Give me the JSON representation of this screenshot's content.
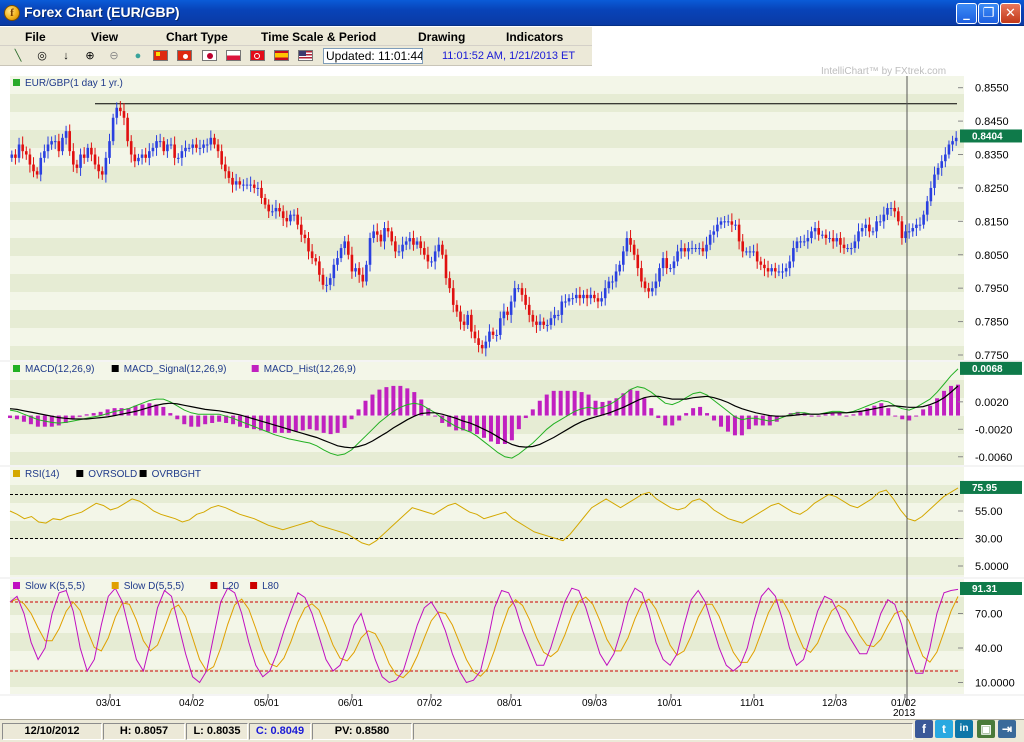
{
  "window": {
    "title": "Forex Chart (EUR/GBP)",
    "app_icon_glyph": "f",
    "controls": [
      "_",
      "❐",
      "✕"
    ]
  },
  "menu": [
    "File",
    "View",
    "Chart Type",
    "Time Scale & Period",
    "Drawing",
    "Indicators"
  ],
  "toolbar": {
    "tools": [
      {
        "name": "line-tool-icon",
        "glyph": "╲"
      },
      {
        "name": "crosshair-icon",
        "glyph": "◎"
      },
      {
        "name": "arrow-down-icon",
        "glyph": "↓"
      },
      {
        "name": "zoom-in-icon",
        "glyph": "⊕"
      },
      {
        "name": "zoom-out-icon",
        "glyph": "⊖"
      },
      {
        "name": "globe-icon",
        "glyph": "●"
      }
    ],
    "flags": [
      {
        "name": "flag-china-icon",
        "colors": [
          "#de2910",
          "#de2910"
        ]
      },
      {
        "name": "flag-hong-kong-icon",
        "colors": [
          "#de2910",
          "#de2910"
        ]
      },
      {
        "name": "flag-japan-icon",
        "colors": [
          "#ffffff",
          "#bc002d"
        ]
      },
      {
        "name": "flag-poland-icon",
        "colors": [
          "#ffffff",
          "#dc143c"
        ]
      },
      {
        "name": "flag-turkey-icon",
        "colors": [
          "#e30a17",
          "#e30a17"
        ]
      },
      {
        "name": "flag-spain-icon",
        "colors": [
          "#c60b1e",
          "#ffc400"
        ]
      },
      {
        "name": "flag-usa-icon",
        "colors": [
          "#b22234",
          "#3c3b6e"
        ]
      }
    ],
    "updated_label": "Updated: 11:01:44",
    "updated_time": "11:01:52 AM, 1/21/2013 ET"
  },
  "watermark": "IntelliChart™ by FXtrek.com",
  "colors": {
    "up_candle": "#2a40e0",
    "down_candle": "#e01010",
    "macd": "#22b022",
    "signal": "#000000",
    "hist": "#c020c0",
    "rsi": "#d4a800",
    "slow_k": "#c010c0",
    "slow_d": "#e0a000",
    "band_light": "#f3f6e8",
    "band_dark": "#e6ecd4",
    "tag_bg": "#0f7a4a"
  },
  "chart_data": [
    {
      "type": "candlestick",
      "legend": "EUR/GBP(1 day  1 yr.)",
      "y_ticks": [
        "0.8550",
        "0.8450",
        "0.8350",
        "0.8250",
        "0.8150",
        "0.8050",
        "0.7950",
        "0.7850",
        "0.7750"
      ],
      "ylim": [
        0.7735,
        0.8585
      ],
      "last_value": "0.8404",
      "resistance": 0.8502,
      "x_labels": [
        "03/01",
        "04/02",
        "05/01",
        "06/01",
        "07/02",
        "08/01",
        "09/03",
        "10/01",
        "11/01",
        "12/03",
        "01/02"
      ],
      "year_label": "2013",
      "closes": [
        0.835,
        0.834,
        0.838,
        0.836,
        0.835,
        0.832,
        0.83,
        0.829,
        0.834,
        0.836,
        0.838,
        0.839,
        0.839,
        0.836,
        0.84,
        0.842,
        0.836,
        0.832,
        0.831,
        0.835,
        0.834,
        0.837,
        0.835,
        0.832,
        0.83,
        0.829,
        0.834,
        0.839,
        0.846,
        0.849,
        0.848,
        0.846,
        0.839,
        0.835,
        0.833,
        0.834,
        0.835,
        0.834,
        0.836,
        0.837,
        0.839,
        0.839,
        0.836,
        0.838,
        0.838,
        0.834,
        0.834,
        0.836,
        0.837,
        0.837,
        0.838,
        0.837,
        0.837,
        0.838,
        0.838,
        0.84,
        0.838,
        0.836,
        0.832,
        0.83,
        0.828,
        0.826,
        0.827,
        0.826,
        0.826,
        0.826,
        0.826,
        0.825,
        0.825,
        0.822,
        0.82,
        0.818,
        0.818,
        0.819,
        0.818,
        0.816,
        0.815,
        0.817,
        0.817,
        0.814,
        0.811,
        0.81,
        0.806,
        0.804,
        0.803,
        0.799,
        0.796,
        0.796,
        0.798,
        0.802,
        0.804,
        0.807,
        0.809,
        0.805,
        0.8,
        0.801,
        0.799,
        0.797,
        0.802,
        0.81,
        0.812,
        0.811,
        0.809,
        0.813,
        0.812,
        0.809,
        0.806,
        0.806,
        0.808,
        0.809,
        0.81,
        0.808,
        0.809,
        0.807,
        0.805,
        0.803,
        0.803,
        0.806,
        0.808,
        0.805,
        0.798,
        0.795,
        0.79,
        0.788,
        0.785,
        0.784,
        0.787,
        0.782,
        0.78,
        0.778,
        0.777,
        0.779,
        0.782,
        0.781,
        0.781,
        0.786,
        0.788,
        0.787,
        0.791,
        0.795,
        0.795,
        0.793,
        0.79,
        0.787,
        0.785,
        0.784,
        0.785,
        0.784,
        0.784,
        0.786,
        0.787,
        0.787,
        0.791,
        0.791,
        0.792,
        0.792,
        0.793,
        0.792,
        0.793,
        0.792,
        0.793,
        0.792,
        0.791,
        0.792,
        0.795,
        0.797,
        0.797,
        0.8,
        0.802,
        0.806,
        0.81,
        0.808,
        0.805,
        0.801,
        0.797,
        0.795,
        0.794,
        0.795,
        0.797,
        0.801,
        0.804,
        0.801,
        0.801,
        0.803,
        0.806,
        0.807,
        0.806,
        0.807,
        0.807,
        0.807,
        0.807,
        0.806,
        0.808,
        0.811,
        0.812,
        0.814,
        0.815,
        0.815,
        0.815,
        0.814,
        0.814,
        0.809,
        0.806,
        0.806,
        0.806,
        0.806,
        0.803,
        0.802,
        0.801,
        0.8,
        0.801,
        0.8,
        0.8,
        0.8,
        0.801,
        0.803,
        0.807,
        0.809,
        0.809,
        0.809,
        0.81,
        0.812,
        0.813,
        0.811,
        0.811,
        0.81,
        0.81,
        0.809,
        0.81,
        0.808,
        0.807,
        0.807,
        0.807,
        0.809,
        0.812,
        0.813,
        0.814,
        0.812,
        0.812,
        0.815,
        0.815,
        0.817,
        0.819,
        0.819,
        0.818,
        0.815,
        0.81,
        0.812,
        0.812,
        0.813,
        0.814,
        0.814,
        0.817,
        0.821,
        0.825,
        0.829,
        0.831,
        0.833,
        0.835,
        0.838,
        0.839,
        0.84
      ],
      "indicator_series_note": "indicator panels follow"
    },
    {
      "type": "line",
      "legend": [
        "MACD(12,26,9)",
        "MACD_Signal(12,26,9)",
        "MACD_Hist(12,26,9)"
      ],
      "y_ticks": [
        "0.0020",
        "-0.0020",
        "-0.0060"
      ],
      "last_value": "0.0068",
      "macd": [
        0.0008,
        0.0006,
        0.0002,
        -0.0002,
        -0.0006,
        -0.0008,
        -0.001,
        -0.0011,
        -0.001,
        -0.0008,
        -0.0006,
        -0.0004,
        -0.0002,
        0.0,
        0.0003,
        0.0006,
        0.0008,
        0.001,
        0.0014,
        0.0018,
        0.0022,
        0.0024,
        0.0024,
        0.002,
        0.0014,
        0.0008,
        0.0004,
        0.0002,
        0.0002,
        0.0002,
        0.0002,
        -0.0001,
        -0.0004,
        -0.0008,
        -0.0012,
        -0.0016,
        -0.002,
        -0.0024,
        -0.0028,
        -0.0031,
        -0.0034,
        -0.0036,
        -0.0038,
        -0.004,
        -0.0044,
        -0.005,
        -0.0055,
        -0.0058,
        -0.0056,
        -0.005,
        -0.004,
        -0.003,
        -0.002,
        -0.001,
        -0.0002,
        0.0006,
        0.0012,
        0.0016,
        0.0018,
        0.0016,
        0.001,
        0.0004,
        -0.0004,
        -0.001,
        -0.0016,
        -0.002,
        -0.0024,
        -0.003,
        -0.0038,
        -0.0046,
        -0.0054,
        -0.006,
        -0.0062,
        -0.0056,
        -0.0048,
        -0.004,
        -0.003,
        -0.002,
        -0.0012,
        -0.0006,
        0.0,
        0.0006,
        0.001,
        0.0012,
        0.001,
        0.0012,
        0.0016,
        0.0022,
        0.003,
        0.0038,
        0.0042,
        0.004,
        0.0034,
        0.0026,
        0.0018,
        0.0016,
        0.002,
        0.0026,
        0.0032,
        0.0034,
        0.003,
        0.0022,
        0.0014,
        0.0006,
        -0.0002,
        -0.0006,
        -0.0004,
        -0.0004,
        -0.0006,
        -0.0008,
        -0.0006,
        -0.0002,
        0.0002,
        0.0004,
        0.0004,
        0.0002,
        0.0002,
        0.0004,
        0.0006,
        0.0006,
        0.0004,
        0.0006,
        0.001,
        0.0014,
        0.0018,
        0.0022,
        0.002,
        0.0014,
        0.001,
        0.0008,
        0.0012,
        0.0018,
        0.0024,
        0.0034,
        0.0046,
        0.0058,
        0.0068
      ],
      "signal": [
        0.001,
        0.0009,
        0.0007,
        0.0005,
        0.0003,
        0.0001,
        -0.0001,
        -0.0003,
        -0.0004,
        -0.0005,
        -0.0005,
        -0.0005,
        -0.0004,
        -0.0003,
        -0.0002,
        0.0,
        0.0002,
        0.0004,
        0.0006,
        0.0009,
        0.0012,
        0.0015,
        0.0017,
        0.0018,
        0.0017,
        0.0015,
        0.0013,
        0.0011,
        0.0009,
        0.0008,
        0.0007,
        0.0005,
        0.0003,
        0.0001,
        -0.0002,
        -0.0005,
        -0.0008,
        -0.0011,
        -0.0014,
        -0.0017,
        -0.002,
        -0.0023,
        -0.0026,
        -0.0029,
        -0.0032,
        -0.0036,
        -0.004,
        -0.0044,
        -0.0046,
        -0.0047,
        -0.0045,
        -0.0042,
        -0.0037,
        -0.0031,
        -0.0025,
        -0.0018,
        -0.0012,
        -0.0006,
        -0.0001,
        0.0003,
        0.0004,
        0.0004,
        0.0002,
        -0.0001,
        -0.0004,
        -0.0008,
        -0.0011,
        -0.0015,
        -0.002,
        -0.0025,
        -0.0031,
        -0.0037,
        -0.0042,
        -0.0045,
        -0.0046,
        -0.0045,
        -0.0042,
        -0.0037,
        -0.0032,
        -0.0026,
        -0.002,
        -0.0014,
        -0.0009,
        -0.0005,
        -0.0002,
        0.0001,
        0.0004,
        0.0008,
        0.0012,
        0.0017,
        0.0022,
        0.0026,
        0.0028,
        0.0028,
        0.0026,
        0.0024,
        0.0024,
        0.0024,
        0.0026,
        0.0027,
        0.0028,
        0.0026,
        0.0023,
        0.0019,
        0.0014,
        0.001,
        0.0007,
        0.0004,
        0.0002,
        0.0,
        -0.0001,
        -0.0001,
        0.0,
        0.0001,
        0.0002,
        0.0002,
        0.0002,
        0.0003,
        0.0004,
        0.0004,
        0.0004,
        0.0005,
        0.0006,
        0.0008,
        0.001,
        0.0012,
        0.0014,
        0.0014,
        0.0013,
        0.0012,
        0.0012,
        0.0013,
        0.0016,
        0.002,
        0.0026,
        0.0034,
        0.0043
      ]
    },
    {
      "type": "line",
      "legend": [
        "RSI(14)",
        "OVRSOLD",
        "OVRBGHT"
      ],
      "y_ticks": [
        "55.00",
        "30.00",
        "5.0000"
      ],
      "last_value": "75.95",
      "overbought": 70,
      "oversold": 30,
      "rsi": [
        55,
        52,
        48,
        50,
        45,
        44,
        48,
        47,
        50,
        52,
        54,
        58,
        62,
        60,
        56,
        58,
        62,
        66,
        64,
        60,
        55,
        52,
        50,
        48,
        45,
        47,
        52,
        54,
        58,
        60,
        58,
        55,
        52,
        50,
        48,
        45,
        42,
        40,
        38,
        40,
        42,
        44,
        46,
        42,
        40,
        38,
        36,
        34,
        30,
        26,
        24,
        28,
        34,
        40,
        46,
        52,
        58,
        56,
        54,
        52,
        56,
        60,
        62,
        58,
        54,
        52,
        48,
        50,
        52,
        54,
        48,
        44,
        40,
        36,
        34,
        32,
        30,
        28,
        34,
        42,
        50,
        58,
        62,
        66,
        62,
        58,
        62,
        66,
        70,
        72,
        66,
        62,
        58,
        56,
        58,
        64,
        66,
        62,
        56,
        52,
        48,
        46,
        44,
        48,
        52,
        56,
        60,
        62,
        58,
        54,
        52,
        56,
        62,
        66,
        70,
        68,
        64,
        60,
        58,
        62,
        66,
        72,
        74,
        66,
        56,
        48,
        46,
        50,
        56,
        62,
        68,
        72,
        76
      ]
    },
    {
      "type": "line",
      "legend": [
        "Slow K(5,5,5)",
        "Slow D(5,5,5)",
        "L20",
        "L80"
      ],
      "y_ticks": [
        "70.00",
        "40.00",
        "10.0000"
      ],
      "last_value": "91.31",
      "l80": 80,
      "l20": 20,
      "slow_k": [
        80,
        85,
        70,
        45,
        30,
        40,
        70,
        88,
        90,
        72,
        40,
        20,
        30,
        60,
        85,
        92,
        80,
        55,
        30,
        20,
        45,
        75,
        90,
        85,
        60,
        35,
        15,
        10,
        20,
        50,
        80,
        92,
        88,
        70,
        45,
        25,
        15,
        20,
        35,
        55,
        72,
        88,
        84,
        70,
        50,
        30,
        20,
        25,
        40,
        60,
        70,
        50,
        30,
        15,
        10,
        12,
        20,
        40,
        60,
        75,
        80,
        70,
        55,
        35,
        20,
        10,
        12,
        20,
        45,
        75,
        90,
        88,
        75,
        55,
        40,
        25,
        25,
        40,
        60,
        80,
        92,
        90,
        75,
        55,
        35,
        25,
        35,
        55,
        80,
        92,
        88,
        70,
        45,
        30,
        25,
        35,
        60,
        82,
        90,
        80,
        60,
        40,
        25,
        20,
        25,
        40,
        65,
        85,
        92,
        85,
        65,
        40,
        25,
        30,
        50,
        72,
        85,
        82,
        70,
        55,
        45,
        35,
        35,
        50,
        70,
        82,
        78,
        60,
        35,
        18,
        18,
        40,
        70,
        88,
        90,
        91
      ]
    }
  ],
  "status": {
    "date": "12/10/2012",
    "high": "H: 0.8057",
    "low": "L: 0.8035",
    "close": "C: 0.8049",
    "pv": "PV: 0.8580"
  },
  "social": [
    {
      "name": "facebook-icon",
      "glyph": "f",
      "color": "#3b5998"
    },
    {
      "name": "twitter-icon",
      "glyph": "t",
      "color": "#29a9e1"
    },
    {
      "name": "linkedin-icon",
      "glyph": "in",
      "color": "#0e76a8"
    },
    {
      "name": "tile-windows-icon",
      "glyph": "▣",
      "color": "#4a7a3a"
    },
    {
      "name": "exit-icon",
      "glyph": "⇥",
      "color": "#3a6a9a"
    }
  ]
}
